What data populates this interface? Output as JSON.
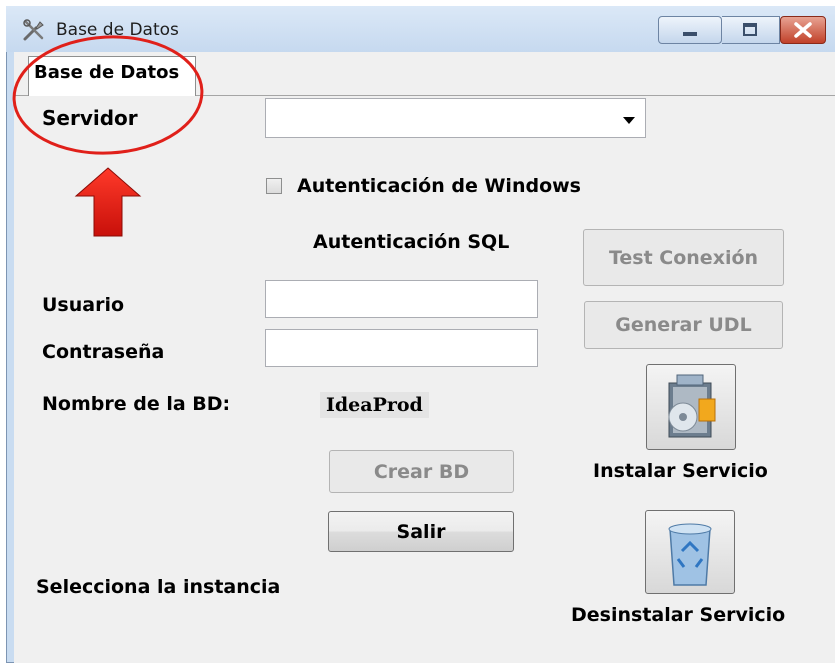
{
  "window": {
    "title": "Base de Datos",
    "icon": "tools-icon"
  },
  "tab": {
    "label": "Base de Datos"
  },
  "form": {
    "server_label": "Servidor",
    "server_value": "",
    "windows_auth_label": "Autenticación de Windows",
    "windows_auth_checked": false,
    "sql_auth_heading": "Autenticación SQL",
    "user_label": "Usuario",
    "user_value": "",
    "password_label": "Contraseña",
    "password_value": "",
    "dbname_label": "Nombre de la BD:",
    "dbname_value": "IdeaProd",
    "select_instance_label": "Selecciona la instancia"
  },
  "buttons": {
    "test_connection": "Test Conexión",
    "generate_udl": "Generar UDL",
    "create_db": "Crear BD",
    "exit": "Salir",
    "install_service": "Instalar Servicio",
    "uninstall_service": "Desinstalar Servicio"
  },
  "annotation": {
    "color": "#e0201a"
  },
  "icons": {
    "dropdown": "chevron-down-icon",
    "install": "install-package-icon",
    "uninstall": "recycle-bin-icon"
  }
}
